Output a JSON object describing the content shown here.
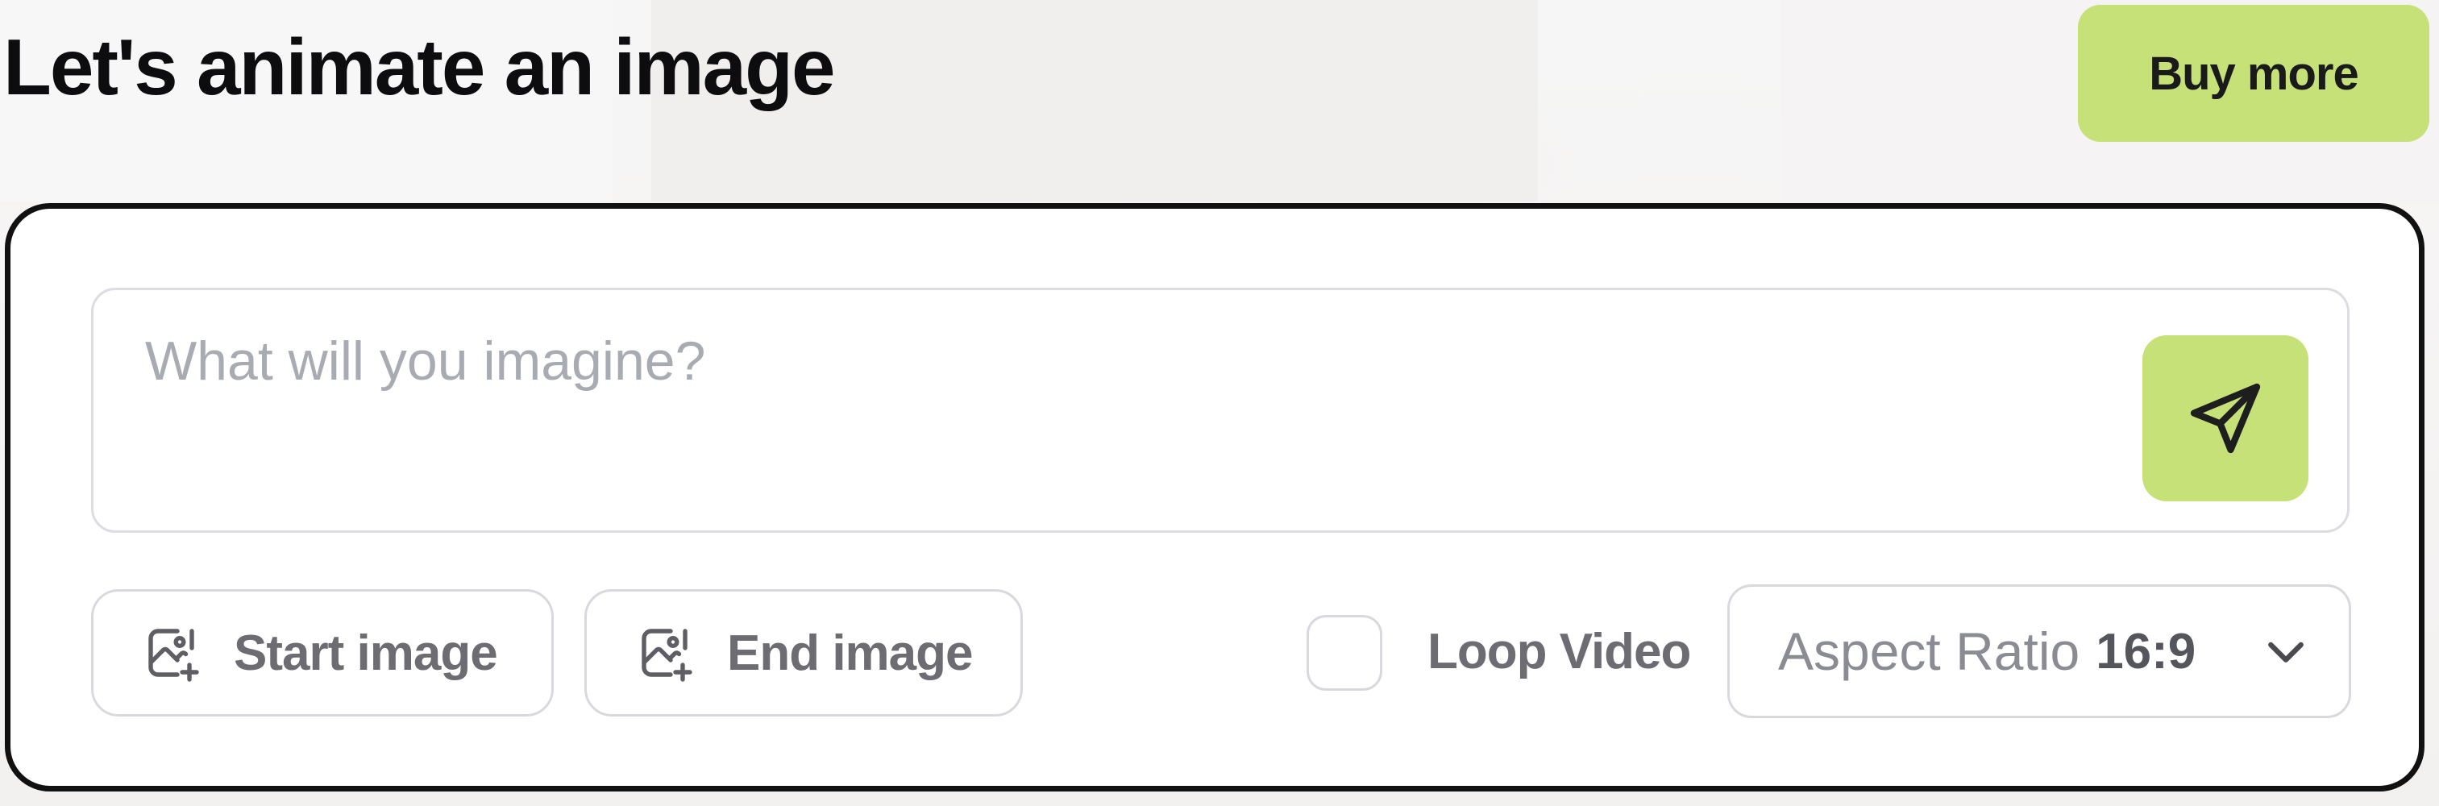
{
  "header": {
    "title": "Let's animate an image",
    "buy_button_label": "Buy more"
  },
  "composer": {
    "prompt": {
      "placeholder": "What will you imagine?",
      "value": ""
    },
    "send_icon": "send-paper-plane-icon",
    "start_image": {
      "label": "Start image",
      "icon": "image-add-icon"
    },
    "end_image": {
      "label": "End image",
      "icon": "image-add-icon"
    },
    "loop_video": {
      "label": "Loop Video",
      "checked": false
    },
    "aspect_ratio": {
      "label": "Aspect Ratio",
      "value": "16:9",
      "icon": "chevron-down-icon"
    }
  },
  "colors": {
    "accent": "#c5e178",
    "border_dark": "#111111",
    "border_light": "#d8d9de",
    "muted_text": "#6c6c72",
    "placeholder": "#a9abb3"
  }
}
